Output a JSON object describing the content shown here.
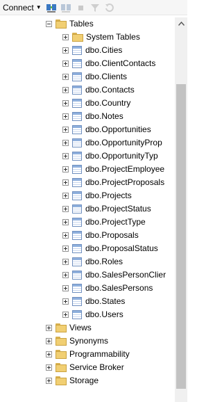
{
  "toolbar": {
    "connect_label": "Connect",
    "icons": [
      "connect-object-explorer-icon",
      "disconnect-icon",
      "stop-icon",
      "filter-icon",
      "refresh-icon"
    ]
  },
  "tree": {
    "tables": {
      "label": "Tables",
      "children": [
        {
          "type": "folder",
          "label": "System Tables"
        },
        {
          "type": "table",
          "label": "dbo.Cities"
        },
        {
          "type": "table",
          "label": "dbo.ClientContacts"
        },
        {
          "type": "table",
          "label": "dbo.Clients"
        },
        {
          "type": "table",
          "label": "dbo.Contacts"
        },
        {
          "type": "table",
          "label": "dbo.Country"
        },
        {
          "type": "table",
          "label": "dbo.Notes"
        },
        {
          "type": "table",
          "label": "dbo.Opportunities"
        },
        {
          "type": "table",
          "label": "dbo.OpportunityProp"
        },
        {
          "type": "table",
          "label": "dbo.OpportunityTyp"
        },
        {
          "type": "table",
          "label": "dbo.ProjectEmployee"
        },
        {
          "type": "table",
          "label": "dbo.ProjectProposals"
        },
        {
          "type": "table",
          "label": "dbo.Projects"
        },
        {
          "type": "table",
          "label": "dbo.ProjectStatus"
        },
        {
          "type": "table",
          "label": "dbo.ProjectType"
        },
        {
          "type": "table",
          "label": "dbo.Proposals"
        },
        {
          "type": "table",
          "label": "dbo.ProposalStatus"
        },
        {
          "type": "table",
          "label": "dbo.Roles"
        },
        {
          "type": "table",
          "label": "dbo.SalesPersonClier"
        },
        {
          "type": "table",
          "label": "dbo.SalesPersons"
        },
        {
          "type": "table",
          "label": "dbo.States"
        },
        {
          "type": "table",
          "label": "dbo.Users"
        }
      ]
    },
    "siblings": [
      "Views",
      "Synonyms",
      "Programmability",
      "Service Broker",
      "Storage"
    ]
  }
}
